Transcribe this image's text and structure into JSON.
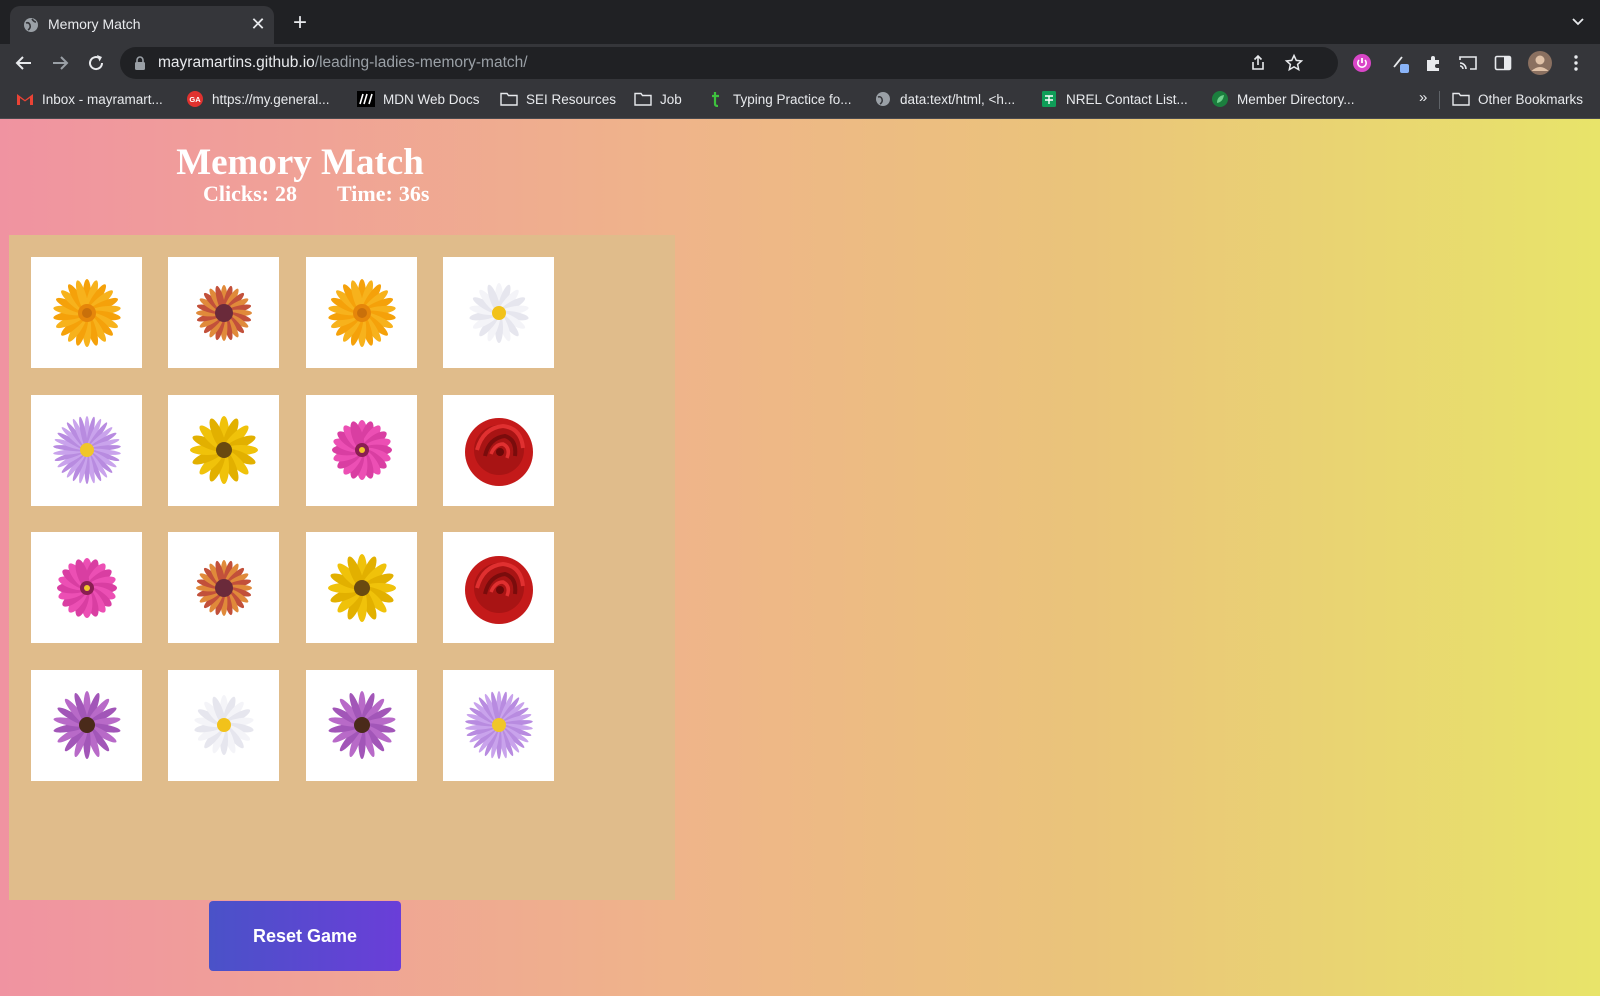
{
  "browser": {
    "tab": {
      "title": "Memory Match"
    },
    "address_bar": {
      "host": "mayramartins.github.io",
      "path": "/leading-ladies-memory-match/"
    },
    "bookmarks": [
      {
        "label": "Inbox - mayramart...",
        "icon": "gmail-icon"
      },
      {
        "label": "https://my.general...",
        "icon": "ga-icon"
      },
      {
        "label": "MDN Web Docs",
        "icon": "mdn-icon"
      },
      {
        "label": "SEI Resources",
        "icon": "folder-icon"
      },
      {
        "label": "Job",
        "icon": "folder-icon"
      },
      {
        "label": "Typing Practice fo...",
        "icon": "typing-icon"
      },
      {
        "label": "data:text/html, <h...",
        "icon": "globe-icon"
      },
      {
        "label": "NREL Contact List...",
        "icon": "sheets-icon"
      },
      {
        "label": "Member Directory...",
        "icon": "leaf-icon"
      }
    ],
    "overflow_label": "»",
    "other_bookmarks": "Other Bookmarks"
  },
  "game": {
    "title": "Memory Match",
    "clicks_label": "Clicks:",
    "clicks": "28",
    "time_label": "Time:",
    "time": "36s",
    "reset_label": "Reset Game",
    "cards": [
      "orange-gerbera",
      "red-orange-daisy",
      "orange-gerbera",
      "white-daisy",
      "lavender-aster",
      "yellow-sunflower",
      "pink-zinnia",
      "red-rose",
      "pink-zinnia",
      "red-orange-daisy",
      "yellow-sunflower",
      "red-rose",
      "purple-coneflower",
      "white-daisy",
      "purple-coneflower",
      "lavender-aster"
    ]
  },
  "colors": {
    "board": "#e0bc8b",
    "button_start": "#4a52c8",
    "button_end": "#6a3ed8"
  }
}
